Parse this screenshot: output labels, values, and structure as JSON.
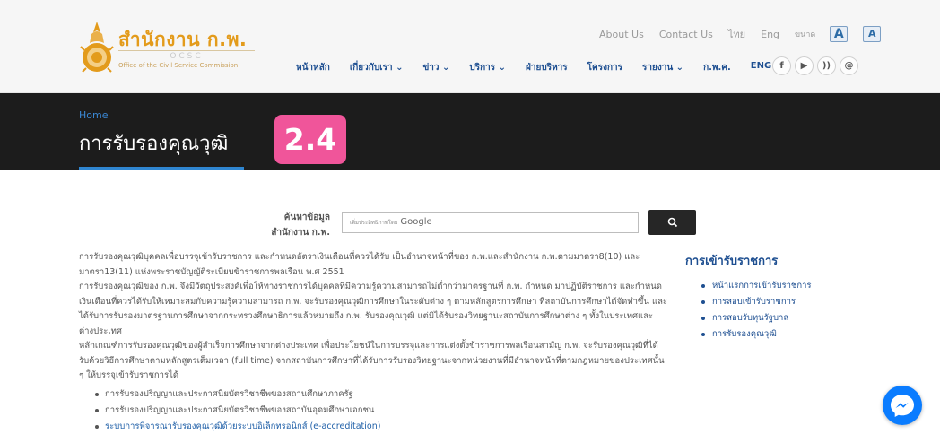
{
  "logo": {
    "title": "สำนักงาน ก.พ.",
    "abbr": "OCSC",
    "subtitle": "Office of the Civil Service Commission"
  },
  "topnav": {
    "about": "About Us",
    "contact": "Contact Us",
    "thai": "ไทย",
    "eng": "Eng",
    "font_size_label": "ขนาด",
    "font_large": "A",
    "font_small": "A"
  },
  "mainnav": {
    "items": [
      "หน้าหลัก",
      "เกี่ยวกับเรา ⌄",
      "ข่าว ⌄",
      "บริการ ⌄",
      "ฝ่ายบริหาร",
      "โครงการ",
      "รายงาน ⌄",
      "ก.พ.ค.",
      "ENG"
    ]
  },
  "social": {
    "facebook": "f",
    "youtube": "▶",
    "rss": "))",
    "email": "@"
  },
  "banner": {
    "breadcrumb": "Home",
    "title": "การรับรองคุณวุฒิ",
    "badge": "2.4"
  },
  "search": {
    "label_line1": "ค้นหาข้อมูล",
    "label_line2": "สำนักงาน ก.พ.",
    "placeholder_prefix": "เพิ่มประสิทธิภาพโดย",
    "placeholder_brand": "Google",
    "button_icon": "search-icon"
  },
  "content": {
    "paragraphs": [
      "การรับรองคุณวุฒิบุคคลเพื่อบรรจุเข้ารับราชการ และกำหนดอัตราเงินเดือนที่ควรได้รับ เป็นอำนาจหน้าที่ของ ก.พ.และสำนักงาน ก.พ.ตามมาตรา8(10) และมาตรา13(11) แห่งพระราชบัญญัติระเบียบข้าราชการพลเรือน พ.ศ 2551",
      "การรับรองคุณวุฒิของ ก.พ. จึงมีวัตถุประสงค์เพื่อให้ทางราชการได้บุคคลที่มีความรู้ความสามารถไม่ต่ำกว่ามาตรฐานที่ ก.พ. กำหนด มาปฏิบัติราชการ และกำหนดเงินเดือนที่ควรได้รับให้เหมาะสมกับความรู้ความสามารถ ก.พ. จะรับรองคุณวุฒิการศึกษาในระดับต่าง ๆ ตามหลักสูตรการศึกษา ที่สถาบันการศึกษาได้จัดทำขึ้น และได้รับการรับรองมาตรฐานการศึกษาจากกระทรวงศึกษาธิการแล้วหมายถึง ก.พ. รับรองคุณวุฒิ แต่มิได้รับรองวิทยฐานะสถาบันการศึกษาต่าง ๆ ทั้งในประเทศและต่างประเทศ",
      "หลักเกณฑ์การรับรองคุณวุฒิของผู้สำเร็จการศึกษาจากต่างประเทศ เพื่อประโยชน์ในการบรรจุและการแต่งตั้งข้าราชการพลเรือนสามัญ ก.พ. จะรับรองคุณวุฒิที่ได้รับด้วยวิธีการศึกษาตามหลักสูตรเต็มเวลา (full time) จากสถาบันการศึกษาที่ได้รับการรับรองวิทยฐานะจากหน่วยงานที่มีอำนาจหน้าที่ตามกฎหมายของประเทศนั้น ๆ ให้บรรจุเข้ารับราชการได้"
    ],
    "bullets": [
      "การรับรองปริญญาและประกาศนียบัตรวิชาชีพของสถานศึกษาภาครัฐ",
      "การรับรองปริญญาและประกาศนียบัตรวิชาชีพของสถาบันอุดมศึกษาเอกชน"
    ],
    "link_bullet": {
      "thai": "ระบบการพิจารณารับรองคุณวุฒิด้วยระบบอิเล็กทรอนิกส์",
      "eng": " (e-accreditation)"
    }
  },
  "sidebar": {
    "title": "การเข้ารับราชการ",
    "items": [
      "หน้าแรกการเข้ารับราชการ",
      "การสอบเข้ารับราชการ",
      "การสอบรับทุนรัฐบาล",
      "การรับรองคุณวุฒิ"
    ]
  },
  "colors": {
    "logo_orange": "#e39b1b",
    "nav_blue": "#1e4f91",
    "banner_bg": "#1c1c1c",
    "badge_pink": "#f0559a",
    "messenger_blue": "#0a7cff"
  }
}
